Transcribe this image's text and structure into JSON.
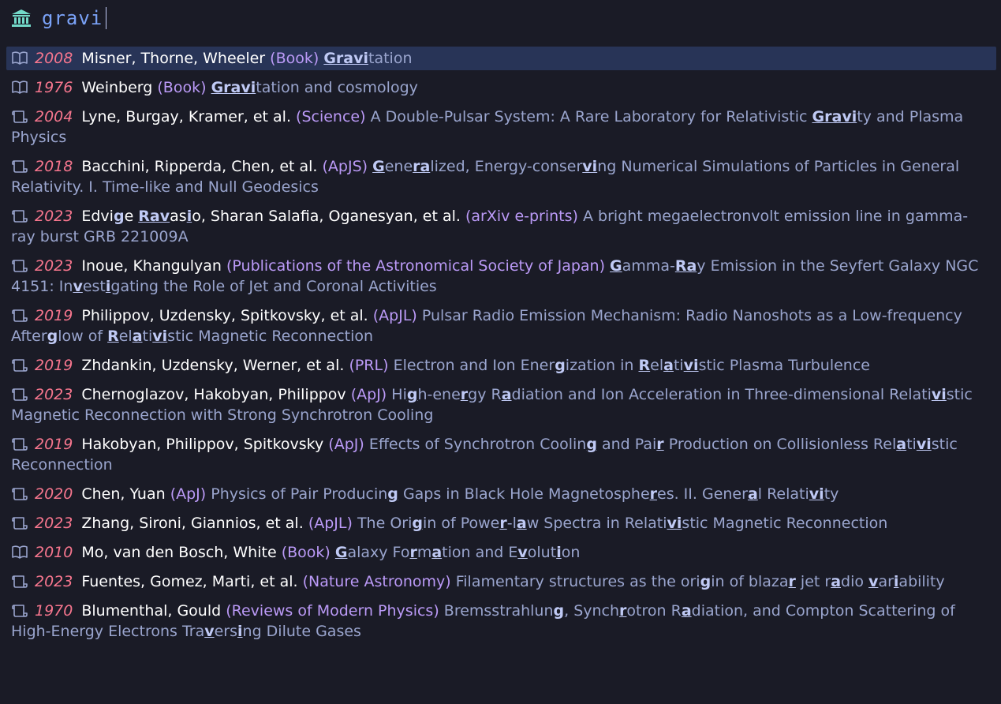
{
  "prompt": {
    "icon": "bank-icon",
    "query": "gravi"
  },
  "colors": {
    "background": "#1a1b26",
    "selection": "#283457",
    "year": "#f7768e",
    "journal": "#bb9af7",
    "title": "#9aa5ce",
    "icon": "#9aa5ce"
  },
  "results": [
    {
      "kind": "book",
      "icon": "book-icon",
      "year": "2008",
      "authors": [
        {
          "t": "Misner, Thorne, Wheeler"
        }
      ],
      "journal": "(Book)",
      "title": [
        {
          "t": "Gravi",
          "m": true
        },
        {
          "t": "tation"
        }
      ]
    },
    {
      "kind": "book",
      "icon": "book-icon",
      "year": "1976",
      "authors": [
        {
          "t": "Weinberg"
        }
      ],
      "journal": "(Book)",
      "title": [
        {
          "t": "Gravi",
          "m": true
        },
        {
          "t": "tation and cosmology"
        }
      ]
    },
    {
      "kind": "article",
      "icon": "scroll-icon",
      "year": "2004",
      "authors": [
        {
          "t": "Lyne, Burgay, Kramer, et al."
        }
      ],
      "journal": "(Science)",
      "title": [
        {
          "t": "A Double-Pulsar System: A Rare Laboratory for Relativistic "
        },
        {
          "t": "Gravi",
          "m": true
        },
        {
          "t": "ty and Plasma Physics"
        }
      ]
    },
    {
      "kind": "article",
      "icon": "scroll-icon",
      "year": "2018",
      "authors": [
        {
          "t": "Bacchini, Ripperda, Chen, et al."
        }
      ],
      "journal": "(ApJS)",
      "title": [
        {
          "t": "G",
          "m": true
        },
        {
          "t": "ene"
        },
        {
          "t": "ra",
          "m": true
        },
        {
          "t": "lized, Energy-conser"
        },
        {
          "t": "vi",
          "m": true
        },
        {
          "t": "ng Numerical Simulations of Particles in General Relativity. I. Time-like and Null Geodesics"
        }
      ]
    },
    {
      "kind": "article",
      "icon": "scroll-icon",
      "year": "2023",
      "authors": [
        {
          "t": "Edvi"
        },
        {
          "t": "g",
          "m": true
        },
        {
          "t": "e "
        },
        {
          "t": "Rav",
          "m": true
        },
        {
          "t": "as"
        },
        {
          "t": "i",
          "m": true
        },
        {
          "t": "o, Sharan Salafia, Oganesyan, et al."
        }
      ],
      "journal": "(arXiv e-prints)",
      "title": [
        {
          "t": "A bright megaelectronvolt emission line in gamma-ray burst GRB 221009A"
        }
      ]
    },
    {
      "kind": "article",
      "icon": "scroll-icon",
      "year": "2023",
      "authors": [
        {
          "t": "Inoue, Khangulyan"
        }
      ],
      "journal": "(Publications of the Astronomical Society of Japan)",
      "title": [
        {
          "t": "G",
          "m": true
        },
        {
          "t": "amma-"
        },
        {
          "t": "Ra",
          "m": true
        },
        {
          "t": "y Emission in the Seyfert Galaxy NGC 4151: In"
        },
        {
          "t": "v",
          "m": true
        },
        {
          "t": "est"
        },
        {
          "t": "i",
          "m": true
        },
        {
          "t": "gating the Role of Jet and Coronal Activities"
        }
      ]
    },
    {
      "kind": "article",
      "icon": "scroll-icon",
      "year": "2019",
      "authors": [
        {
          "t": "Philippov, Uzdensky, Spitkovsky, et al."
        }
      ],
      "journal": "(ApJL)",
      "title": [
        {
          "t": "Pulsar Radio Emission Mechanism: Radio Nanoshots as a Low-frequency After"
        },
        {
          "t": "g",
          "m": true
        },
        {
          "t": "low of "
        },
        {
          "t": "R",
          "m": true
        },
        {
          "t": "el"
        },
        {
          "t": "a",
          "m": true
        },
        {
          "t": "ti"
        },
        {
          "t": "vi",
          "m": true
        },
        {
          "t": "stic Magnetic Reconnection"
        }
      ]
    },
    {
      "kind": "article",
      "icon": "scroll-icon",
      "year": "2019",
      "authors": [
        {
          "t": "Zhdankin, Uzdensky, Werner, et al."
        }
      ],
      "journal": "(PRL)",
      "title": [
        {
          "t": "Electron and Ion Ener"
        },
        {
          "t": "g",
          "m": true
        },
        {
          "t": "ization in "
        },
        {
          "t": "R",
          "m": true
        },
        {
          "t": "el"
        },
        {
          "t": "a",
          "m": true
        },
        {
          "t": "ti"
        },
        {
          "t": "vi",
          "m": true
        },
        {
          "t": "stic Plasma Turbulence"
        }
      ]
    },
    {
      "kind": "article",
      "icon": "scroll-icon",
      "year": "2023",
      "authors": [
        {
          "t": "Chernoglazov, Hakobyan, Philippov"
        }
      ],
      "journal": "(ApJ)",
      "title": [
        {
          "t": "Hi"
        },
        {
          "t": "g",
          "m": true
        },
        {
          "t": "h-ene"
        },
        {
          "t": "r",
          "m": true
        },
        {
          "t": "gy R"
        },
        {
          "t": "a",
          "m": true
        },
        {
          "t": "diation and Ion Acceleration in Three-dimensional Relati"
        },
        {
          "t": "vi",
          "m": true
        },
        {
          "t": "stic Magnetic Reconnection with Strong Synchrotron Cooling"
        }
      ]
    },
    {
      "kind": "article",
      "icon": "scroll-icon",
      "year": "2019",
      "authors": [
        {
          "t": "Hakobyan, Philippov, Spitkovsky"
        }
      ],
      "journal": "(ApJ)",
      "title": [
        {
          "t": "Effects of Synchrotron Coolin"
        },
        {
          "t": "g",
          "m": true
        },
        {
          "t": " and Pai"
        },
        {
          "t": "r",
          "m": true
        },
        {
          "t": " Production on Collisionless Rel"
        },
        {
          "t": "a",
          "m": true
        },
        {
          "t": "ti"
        },
        {
          "t": "vi",
          "m": true
        },
        {
          "t": "stic Reconnection"
        }
      ]
    },
    {
      "kind": "article",
      "icon": "scroll-icon",
      "year": "2020",
      "authors": [
        {
          "t": "Chen, Yuan"
        }
      ],
      "journal": "(ApJ)",
      "title": [
        {
          "t": "Physics of Pair Producin"
        },
        {
          "t": "g",
          "m": true
        },
        {
          "t": " Gaps in Black Hole Magnetosphe"
        },
        {
          "t": "r",
          "m": true
        },
        {
          "t": "es. II. Gener"
        },
        {
          "t": "a",
          "m": true
        },
        {
          "t": "l Relati"
        },
        {
          "t": "vi",
          "m": true
        },
        {
          "t": "ty"
        }
      ]
    },
    {
      "kind": "article",
      "icon": "scroll-icon",
      "year": "2023",
      "authors": [
        {
          "t": "Zhang, Sironi, Giannios, et al."
        }
      ],
      "journal": "(ApJL)",
      "title": [
        {
          "t": "The Ori"
        },
        {
          "t": "g",
          "m": true
        },
        {
          "t": "in of Powe"
        },
        {
          "t": "r",
          "m": true
        },
        {
          "t": "-l"
        },
        {
          "t": "a",
          "m": true
        },
        {
          "t": "w Spectra in Relati"
        },
        {
          "t": "vi",
          "m": true
        },
        {
          "t": "stic Magnetic Reconnection"
        }
      ]
    },
    {
      "kind": "book",
      "icon": "book-icon",
      "year": "2010",
      "authors": [
        {
          "t": "Mo, van den Bosch, White"
        }
      ],
      "journal": "(Book)",
      "title": [
        {
          "t": "G",
          "m": true
        },
        {
          "t": "alaxy Fo"
        },
        {
          "t": "r",
          "m": true
        },
        {
          "t": "m"
        },
        {
          "t": "a",
          "m": true
        },
        {
          "t": "tion and E"
        },
        {
          "t": "v",
          "m": true
        },
        {
          "t": "olut"
        },
        {
          "t": "i",
          "m": true
        },
        {
          "t": "on"
        }
      ]
    },
    {
      "kind": "article",
      "icon": "scroll-icon",
      "year": "2023",
      "authors": [
        {
          "t": "Fuentes, Gomez, Marti, et al."
        }
      ],
      "journal": "(Nature Astronomy)",
      "title": [
        {
          "t": "Filamentary structures as the ori"
        },
        {
          "t": "g",
          "m": true
        },
        {
          "t": "in of blaza"
        },
        {
          "t": "r",
          "m": true
        },
        {
          "t": " jet r"
        },
        {
          "t": "a",
          "m": true
        },
        {
          "t": "dio "
        },
        {
          "t": "v",
          "m": true
        },
        {
          "t": "ar"
        },
        {
          "t": "i",
          "m": true
        },
        {
          "t": "ability"
        }
      ]
    },
    {
      "kind": "article",
      "icon": "scroll-icon",
      "year": "1970",
      "authors": [
        {
          "t": "Blumenthal, Gould"
        }
      ],
      "journal": "(Reviews of Modern Physics)",
      "title": [
        {
          "t": "Bremsstrahlun"
        },
        {
          "t": "g",
          "m": true
        },
        {
          "t": ", Synch"
        },
        {
          "t": "r",
          "m": true
        },
        {
          "t": "otron R"
        },
        {
          "t": "a",
          "m": true
        },
        {
          "t": "diation, and Compton Scattering of High-Energy Electrons Tra"
        },
        {
          "t": "v",
          "m": true
        },
        {
          "t": "ers"
        },
        {
          "t": "i",
          "m": true
        },
        {
          "t": "ng Dilute Gases"
        }
      ]
    }
  ]
}
